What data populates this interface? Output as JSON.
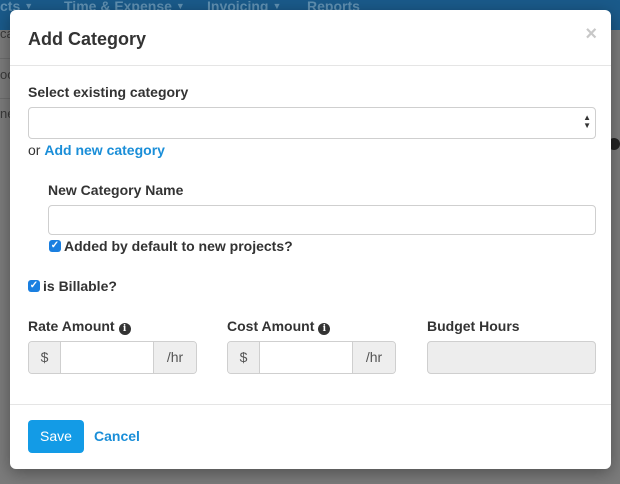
{
  "background": {
    "nav_items": [
      {
        "label": "cts"
      },
      {
        "label": "Time & Expense"
      },
      {
        "label": "Invoicing"
      },
      {
        "label": "Reports"
      }
    ],
    "side_texts": [
      "ca",
      "oo",
      "ne"
    ]
  },
  "modal": {
    "title": "Add Category",
    "close_symbol": "×",
    "existing_category": {
      "label": "Select existing category",
      "value": ""
    },
    "or_text": "or",
    "add_new_link": "Add new category",
    "new_category": {
      "label": "New Category Name",
      "value": ""
    },
    "default_checkbox": {
      "label": "Added by default to new projects?",
      "checked": true
    },
    "billable_checkbox": {
      "label": "is Billable?",
      "checked": true
    },
    "rate_amount": {
      "label": "Rate Amount",
      "prefix": "$",
      "suffix": "/hr",
      "value": ""
    },
    "cost_amount": {
      "label": "Cost Amount",
      "prefix": "$",
      "suffix": "/hr",
      "value": ""
    },
    "budget_hours": {
      "label": "Budget Hours",
      "value": ""
    },
    "save_label": "Save",
    "cancel_label": "Cancel"
  },
  "colors": {
    "primary": "#139be6",
    "link": "#1a8ed8",
    "checkbox": "#1a7fe0"
  }
}
